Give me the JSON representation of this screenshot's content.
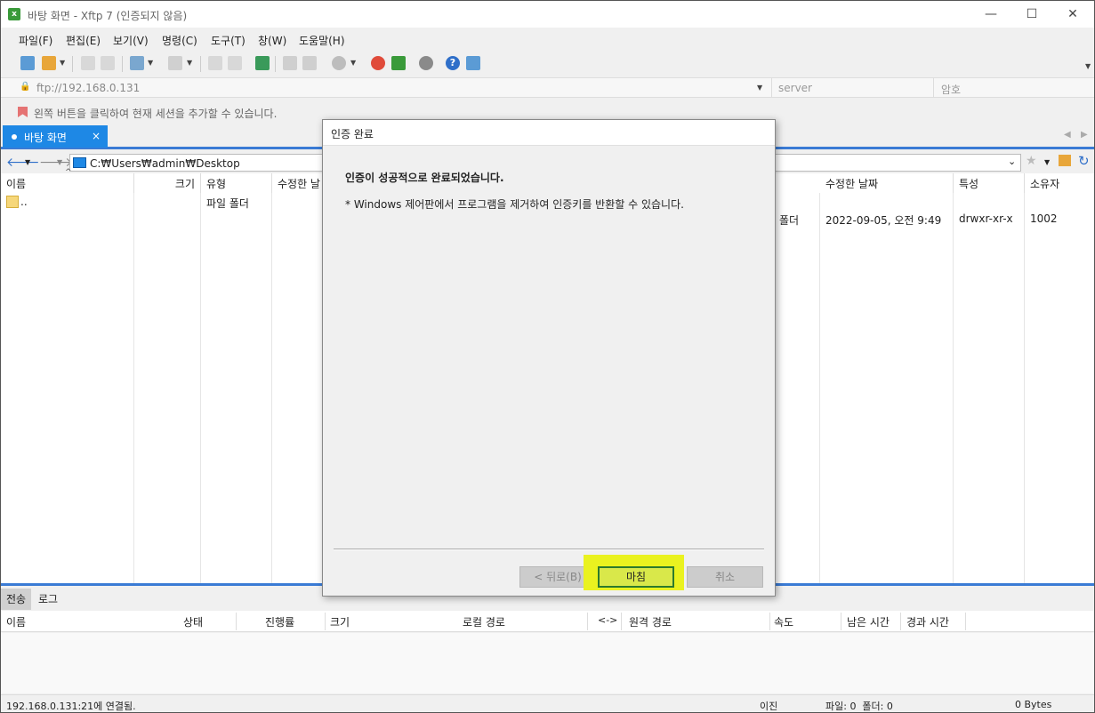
{
  "window": {
    "title": "바탕 화면 - Xftp 7 (인증되지 않음)"
  },
  "menu": [
    "파일(F)",
    "편집(E)",
    "보기(V)",
    "명령(C)",
    "도구(T)",
    "창(W)",
    "도움말(H)"
  ],
  "address": {
    "url": "ftp://192.168.0.131",
    "server_placeholder": "server",
    "password_placeholder": "암호"
  },
  "hint": "왼쪽 버튼을 클릭하여 현재 세션을 추가할 수 있습니다.",
  "tab": {
    "label": "바탕 화면",
    "close": "×"
  },
  "local_path": "C:₩Users₩admin₩Desktop",
  "local_pane": {
    "headers": [
      "이름",
      "크기",
      "유형",
      "수정한 날"
    ],
    "rows": [
      {
        "name": "..",
        "size": "",
        "type": "파일 폴더"
      }
    ]
  },
  "remote_pane": {
    "headers": [
      "수정한 날짜",
      "특성",
      "소유자"
    ],
    "rows": [
      {
        "type_tail": "폴더",
        "modified": "2022-09-05, 오전 9:49",
        "attr": "drwxr-xr-x",
        "owner": "1002"
      }
    ]
  },
  "transfer": {
    "tabs": [
      "전송",
      "로그"
    ],
    "headers": [
      "이름",
      "상태",
      "진행률",
      "크기",
      "로컬 경로",
      "<->",
      "원격 경로",
      "속도",
      "남은 시간",
      "경과 시간"
    ]
  },
  "status": {
    "connection": "192.168.0.131:21에 연결됨.",
    "mode": "이진",
    "counts": "파일: 0  폴더: 0",
    "bytes": "0 Bytes"
  },
  "dialog": {
    "title": "인증 완료",
    "heading": "인증이 성공적으로 완료되었습니다.",
    "note": "* Windows 제어판에서 프로그램을 제거하여 인증키를 반환할 수 있습니다.",
    "back": "< 뒤로(B)",
    "finish": "마침",
    "cancel": "취소"
  },
  "colors": {
    "accent": "#1e88e5",
    "highlight": "#eaf21f",
    "finish_border": "#2c7a2c"
  }
}
